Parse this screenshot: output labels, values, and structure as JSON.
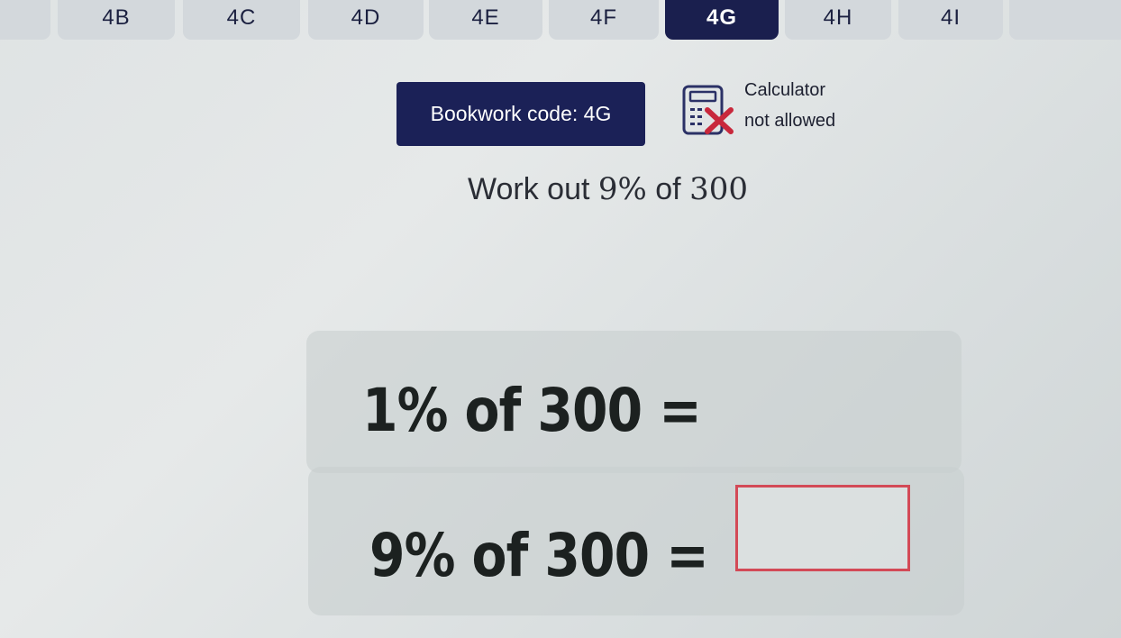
{
  "tabs": [
    {
      "label": "",
      "active": false
    },
    {
      "label": "4B",
      "active": false
    },
    {
      "label": "4C",
      "active": false
    },
    {
      "label": "4D",
      "active": false
    },
    {
      "label": "4E",
      "active": false
    },
    {
      "label": "4F",
      "active": false
    },
    {
      "label": "4G",
      "active": true
    },
    {
      "label": "4H",
      "active": false
    },
    {
      "label": "4I",
      "active": false
    },
    {
      "label": "",
      "active": false
    }
  ],
  "bookwork": {
    "label": "Bookwork code: 4G"
  },
  "calculator": {
    "line1": "Calculator",
    "line2": "not allowed",
    "icon": "calculator-not-allowed-icon"
  },
  "question": {
    "prefix": "Work out ",
    "percent": "9%",
    "middle": " of ",
    "amount": "300"
  },
  "steps": [
    {
      "text": "1% of 300 ="
    },
    {
      "text": "9% of 300 ="
    }
  ],
  "answer": {
    "value": ""
  },
  "colors": {
    "accent_navy": "#1b2157",
    "answer_border": "#d34a57",
    "cross": "#c8283c"
  }
}
